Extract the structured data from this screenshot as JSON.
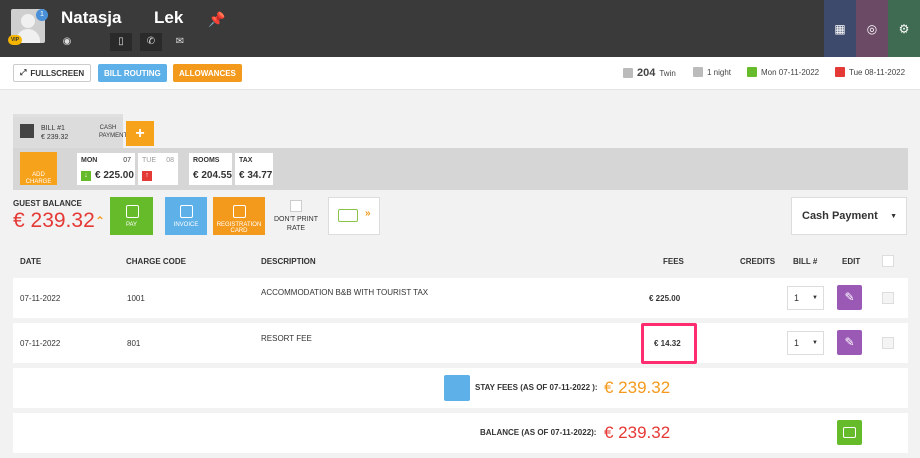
{
  "guest": {
    "first_name": "Natasja",
    "last_name": "Lek",
    "vip_label": "VIP",
    "count": "1"
  },
  "toolbar": {
    "fullscreen": "FULLSCREEN",
    "bill_routing": "BILL ROUTING",
    "allowances": "ALLOWANCES"
  },
  "stay": {
    "room": "204",
    "room_type": "Twin",
    "nights": "1 night",
    "arrival": "Mon 07-11-2022",
    "departure": "Tue 08-11-2022"
  },
  "bill": {
    "name": "BILL #1",
    "amount": "€ 239.32",
    "method": "CASH PAYMENT"
  },
  "charges": {
    "add_charge": "ADD CHARGE",
    "mon_label": "MON",
    "mon_day": "07",
    "mon_amount": "€ 225.00",
    "tue_label": "TUE",
    "tue_day": "08",
    "rooms_label": "ROOMS",
    "rooms_amount": "€ 204.55",
    "tax_label": "TAX",
    "tax_amount": "€ 34.77"
  },
  "balance": {
    "label": "GUEST BALANCE",
    "amount": "€ 239.32"
  },
  "actions": {
    "pay": "PAY",
    "invoice": "INVOICE",
    "registration": "REGISTRATION CARD",
    "dont_print": "DON'T PRINT RATE"
  },
  "payment_select": "Cash Payment",
  "table": {
    "headers": {
      "date": "DATE",
      "code": "CHARGE CODE",
      "desc": "DESCRIPTION",
      "fees": "FEES",
      "credits": "CREDITS",
      "bill": "BILL #",
      "edit": "EDIT"
    },
    "rows": [
      {
        "date": "07-11-2022",
        "code": "1001",
        "desc": "ACCOMMODATION B&B WITH TOURIST TAX",
        "fees": "€ 225.00",
        "bill": "1"
      },
      {
        "date": "07-11-2022",
        "code": "801",
        "desc": "RESORT FEE",
        "fees": "€ 14.32",
        "bill": "1"
      }
    ]
  },
  "summary": {
    "stay_label": "STAY FEES (AS OF  07-11-2022 ):",
    "stay_amount": "€ 239.32",
    "balance_label": "BALANCE (AS OF  07-11-2022):",
    "balance_amount": "€ 239.32"
  },
  "colors": {
    "accent_orange": "#f7a21b",
    "accent_red": "#e53935",
    "pay_green": "#66bb2a",
    "invoice_blue": "#5db0e8",
    "edit_purple": "#9b59b6",
    "highlight": "#ff2d6f"
  }
}
